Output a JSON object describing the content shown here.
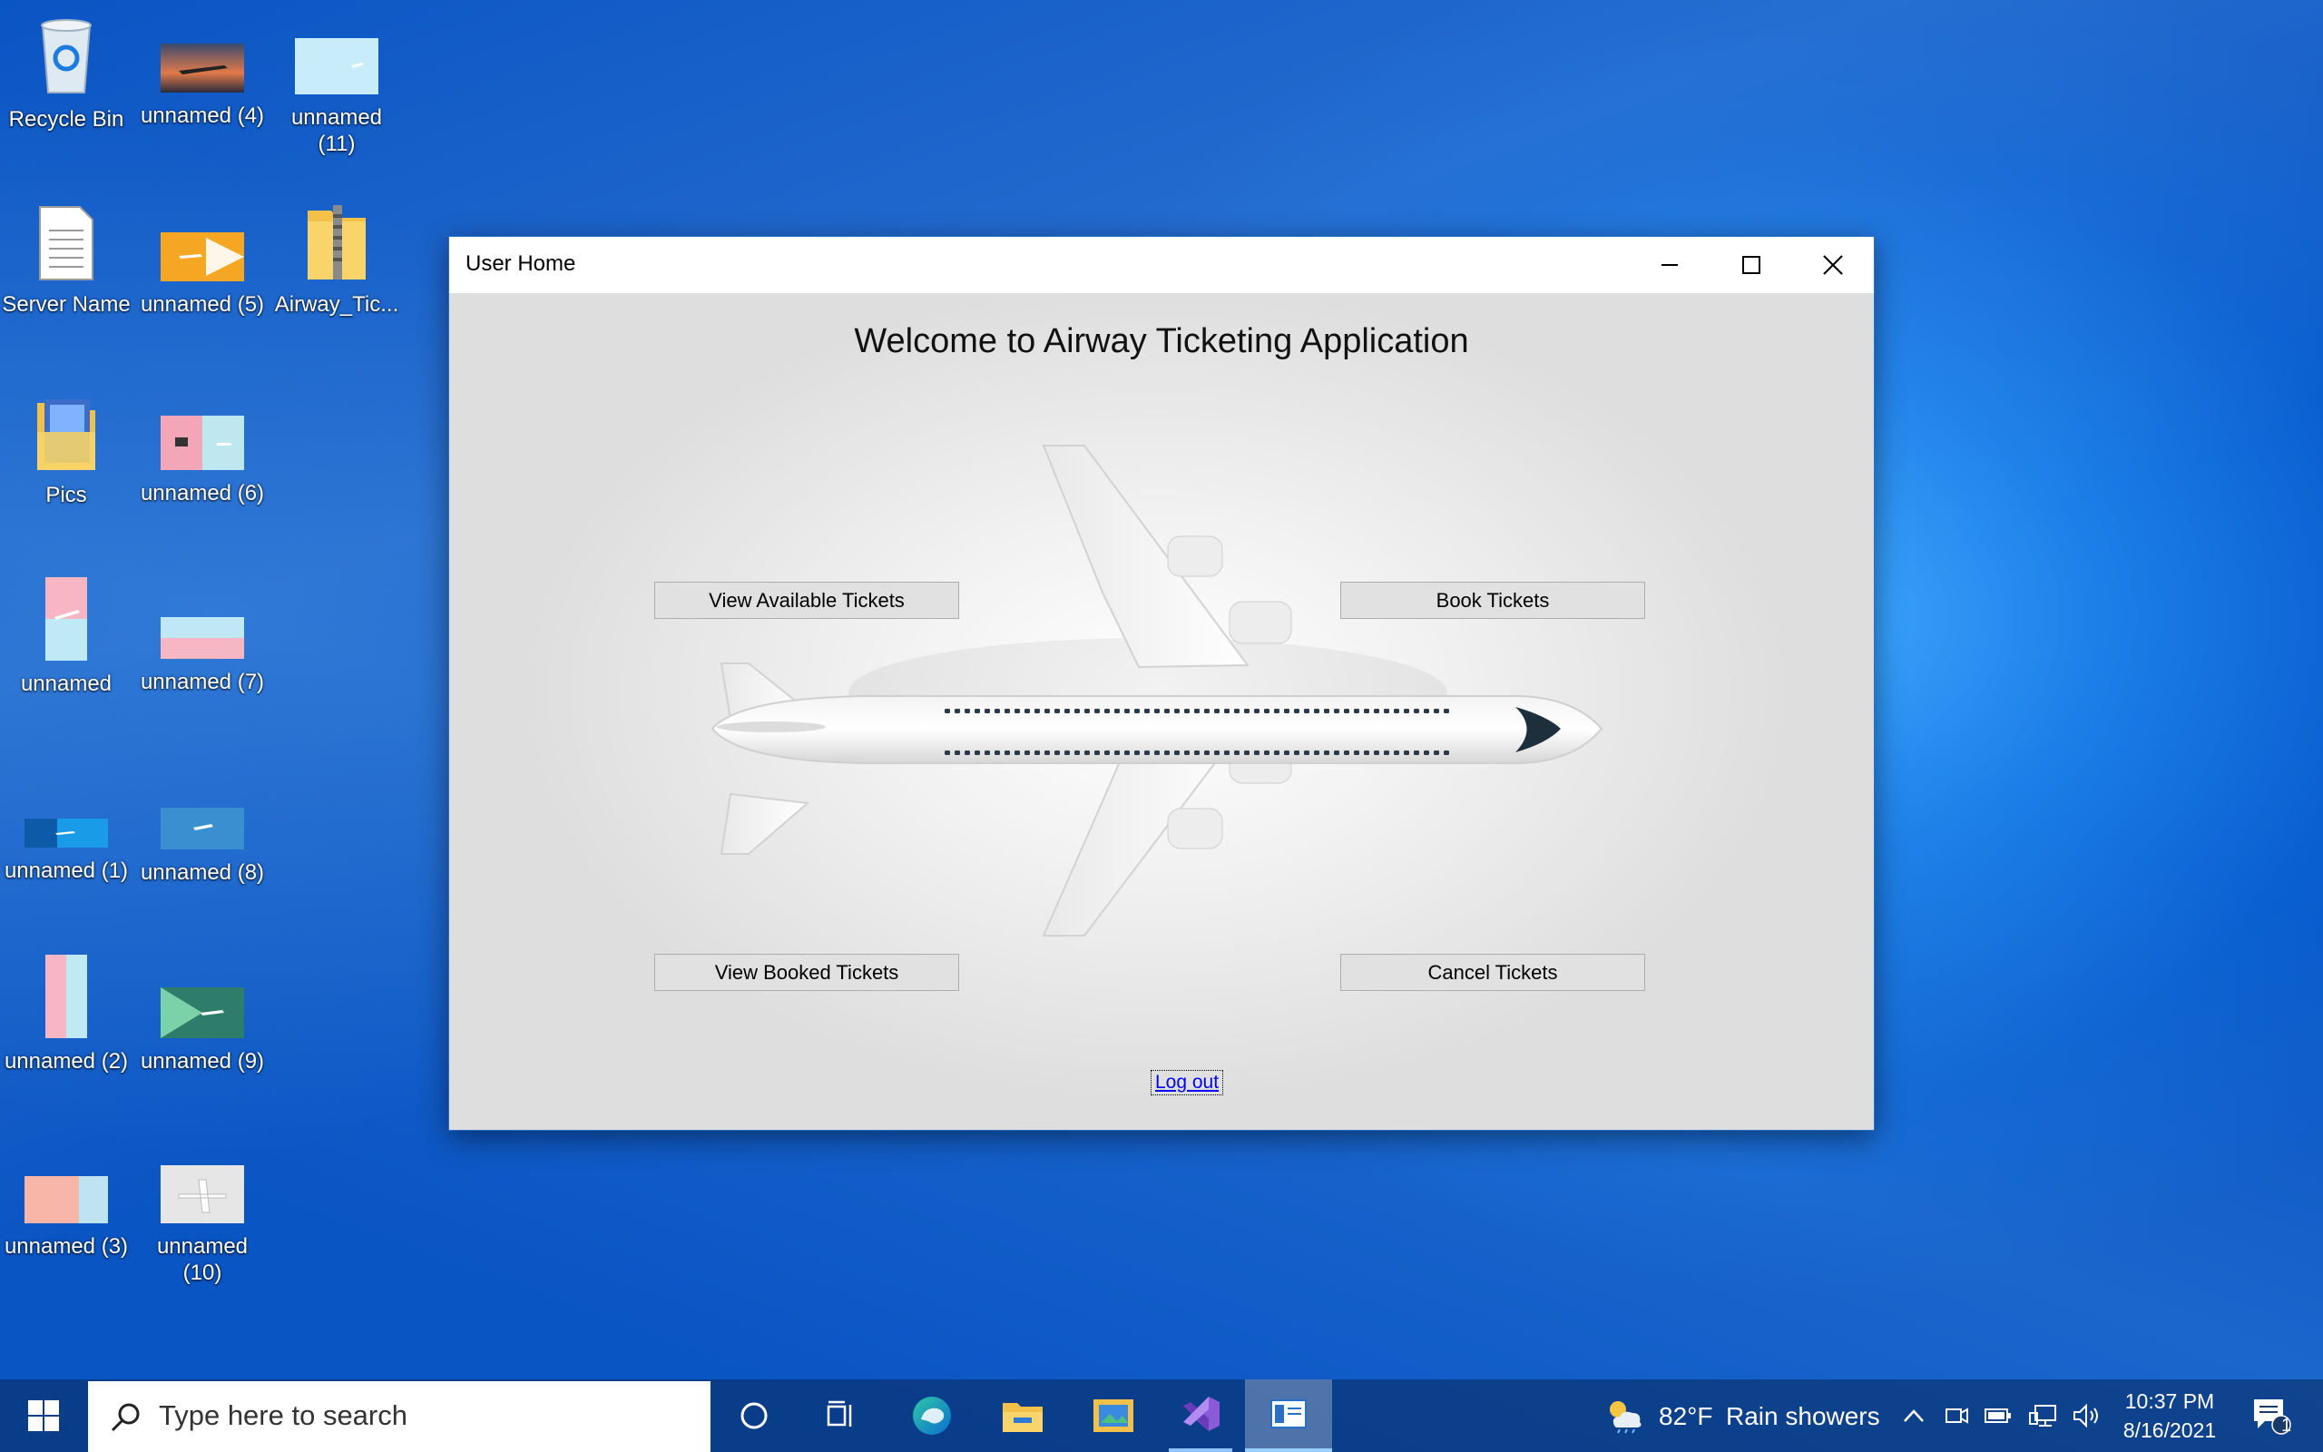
{
  "desktop": {
    "icons": [
      {
        "label": "Recycle Bin",
        "icon": "recycle-bin-icon"
      },
      {
        "label": "unnamed (4)",
        "icon": "image-icon"
      },
      {
        "label": "unnamed\n(11)",
        "icon": "image-icon"
      },
      {
        "label": "Server Name",
        "icon": "text-file-icon"
      },
      {
        "label": "unnamed (5)",
        "icon": "image-icon"
      },
      {
        "label": "Airway_Tic...",
        "icon": "zip-folder-icon"
      },
      {
        "label": "Pics",
        "icon": "folder-icon"
      },
      {
        "label": "unnamed (6)",
        "icon": "image-icon"
      },
      {
        "label": "unnamed",
        "icon": "image-icon"
      },
      {
        "label": "unnamed (7)",
        "icon": "image-icon"
      },
      {
        "label": "unnamed (1)",
        "icon": "image-icon"
      },
      {
        "label": "unnamed (8)",
        "icon": "image-icon"
      },
      {
        "label": "unnamed (2)",
        "icon": "image-icon"
      },
      {
        "label": "unnamed (9)",
        "icon": "image-icon"
      },
      {
        "label": "unnamed (3)",
        "icon": "image-icon"
      },
      {
        "label": "unnamed\n(10)",
        "icon": "image-icon"
      }
    ]
  },
  "window": {
    "title": "User Home",
    "heading": "Welcome to Airway Ticketing Application",
    "buttons": {
      "view_available": "View Available Tickets",
      "book": "Book Tickets",
      "view_booked": "View Booked Tickets",
      "cancel": "Cancel Tickets"
    },
    "logout_label": "Log out"
  },
  "taskbar": {
    "search_placeholder": "Type here to search",
    "weather": {
      "temp": "82°F",
      "condition": "Rain showers"
    },
    "clock": {
      "time": "10:37 PM",
      "date": "8/16/2021"
    },
    "notification_count": "1",
    "pinned": [
      "task-view-icon",
      "edge-icon",
      "file-explorer-icon",
      "photos-icon",
      "visual-studio-icon",
      "app-window-icon"
    ]
  },
  "colors": {
    "accent": "#0a5fd0",
    "window_border": "#2a6fc7",
    "button_bg": "#e1e1e1",
    "link": "#0000ff"
  }
}
